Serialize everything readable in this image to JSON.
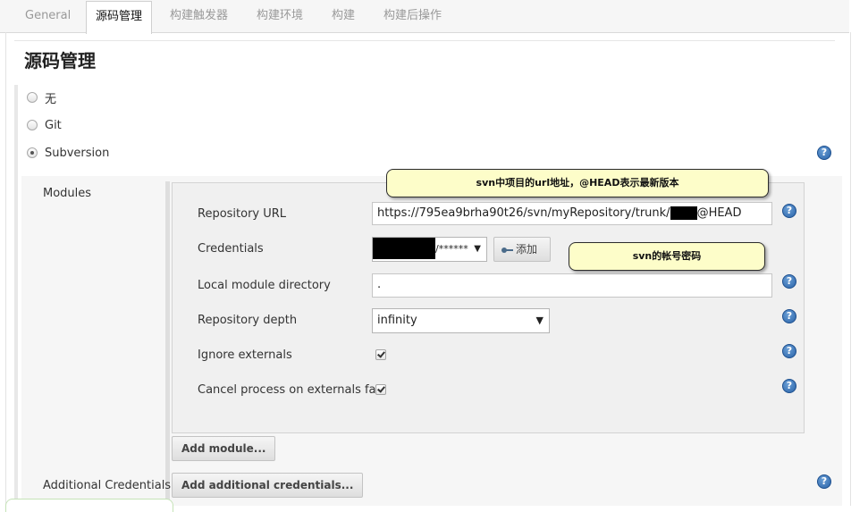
{
  "tabs": [
    "General",
    "源码管理",
    "构建触发器",
    "构建环境",
    "构建",
    "构建后操作"
  ],
  "active_tab": "源码管理",
  "section_title": "源码管理",
  "scm_options": [
    {
      "label": "无",
      "selected": false
    },
    {
      "label": "Git",
      "selected": false
    },
    {
      "label": "Subversion",
      "selected": true
    }
  ],
  "modules": {
    "label": "Modules",
    "repository_url_label": "Repository URL",
    "repository_url_prefix": "https://795ea9brha90t26/svn/myRepository/trunk/",
    "repository_url_suffix": "@HEAD",
    "credentials_label": "Credentials",
    "credentials_value": "/******",
    "add_button": "添加",
    "local_dir_label": "Local module directory",
    "local_dir_value": ".",
    "depth_label": "Repository depth",
    "depth_value": "infinity",
    "ignore_externals_label": "Ignore externals",
    "ignore_externals_checked": true,
    "cancel_process_label": "Cancel process on externals fail",
    "cancel_process_checked": true,
    "add_module_button": "Add module..."
  },
  "additional_credentials": {
    "label": "Additional Credentials",
    "button": "Add additional credentials..."
  },
  "annotations": {
    "url_note": "svn中项目的url地址，@HEAD表示最新版本",
    "credentials_note": "svn的帐号密码"
  },
  "colors": {
    "callout_bg": "#fdfdc9",
    "help_icon": "#2a63a8"
  }
}
